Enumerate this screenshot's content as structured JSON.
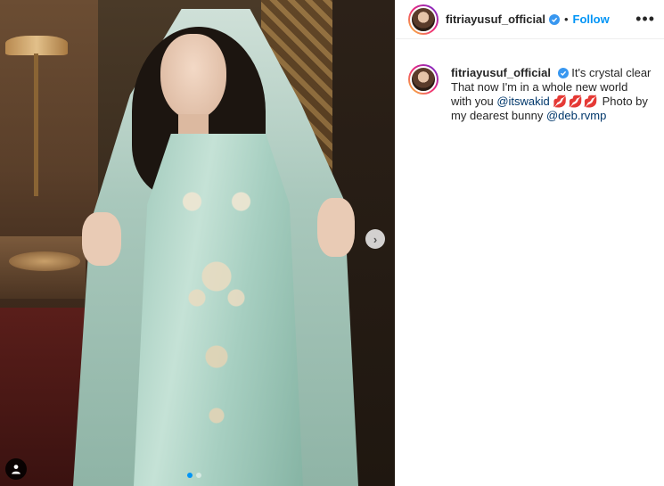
{
  "post": {
    "username": "fitriayusuf_official",
    "follow_label": "Follow",
    "separator": "•",
    "more_label": "•••",
    "next_label": "›",
    "carousel": {
      "total": 2,
      "current": 1
    }
  },
  "caption": {
    "username": "fitriayusuf_official",
    "text_part1": "It's crystal clear That now I'm in a whole new world with you",
    "mention1": "@itswakid",
    "emoji": "💋💋💋",
    "text_part2": "Photo by my dearest bunny",
    "mention2": "@deb.rvmp"
  },
  "colors": {
    "follow": "#0095f6",
    "verified": "#3897f0",
    "mention": "#00376b"
  },
  "icons": {
    "verified": "verified-badge-icon",
    "next": "chevron-right-icon",
    "tagged": "user-icon",
    "more": "more-horizontal-icon"
  }
}
